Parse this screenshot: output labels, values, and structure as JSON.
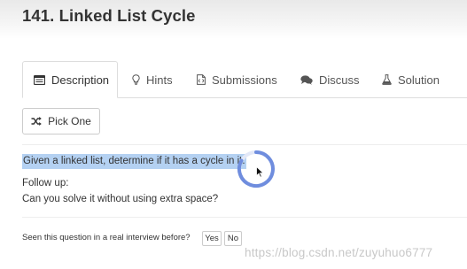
{
  "problem": {
    "title": "141. Linked List Cycle"
  },
  "tabs": [
    {
      "label": "Description",
      "icon": "description-icon",
      "active": true
    },
    {
      "label": "Hints",
      "icon": "lightbulb-icon",
      "active": false
    },
    {
      "label": "Submissions",
      "icon": "submissions-icon",
      "active": false
    },
    {
      "label": "Discuss",
      "icon": "discuss-icon",
      "active": false
    },
    {
      "label": "Solution",
      "icon": "flask-icon",
      "active": false
    }
  ],
  "pick_one": {
    "label": "Pick One",
    "icon": "shuffle-icon"
  },
  "content": {
    "question": "Given a linked list, determine if it has a cycle in it.",
    "follow_up_label": "Follow up:",
    "follow_up_text": "Can you solve it without using extra space?"
  },
  "interview": {
    "question": "Seen this question in a real interview before?",
    "yes_label": "Yes",
    "no_label": "No"
  },
  "watermark": "https://blog.csdn.net/zuyuhuo6777",
  "colors": {
    "selection_highlight": "#b4d1f2",
    "spinner": "#5b7cd9",
    "border": "#dddddd"
  }
}
